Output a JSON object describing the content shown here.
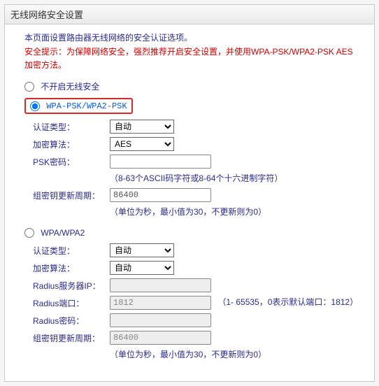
{
  "header": {
    "title": "无线网络安全设置"
  },
  "intro": {
    "line1": "本页面设置路由器无线网络的安全认证选项。",
    "warning": "安全提示：为保障网络安全，强烈推荐开启安全设置，并使用WPA-PSK/WPA2-PSK AES加密方法。"
  },
  "securityMode": {
    "disable": {
      "label": "不开启无线安全",
      "selected": false
    },
    "wpapsk": {
      "label": "WPA-PSK/WPA2-PSK",
      "selected": true
    },
    "wpa": {
      "label": "WPA/WPA2",
      "selected": false
    }
  },
  "wpapsk": {
    "authLabel": "认证类型：",
    "authValue": "自动",
    "encLabel": "加密算法：",
    "encValue": "AES",
    "pskLabel": "PSK密码：",
    "pskValue": "",
    "pskHint": "（8-63个ASCII码字符或8-64个十六进制字符）",
    "groupLabel": "组密钥更新周期：",
    "groupValue": "86400",
    "groupHint": "（单位为秒，最小值为30，不更新则为0）"
  },
  "wpa": {
    "authLabel": "认证类型：",
    "authValue": "自动",
    "encLabel": "加密算法：",
    "encValue": "自动",
    "radiusIpLabel": "Radius服务器IP：",
    "radiusIpValue": "",
    "radiusPortLabel": "Radius端口：",
    "radiusPortValue": "1812",
    "radiusPortHint": "（1- 65535，0表示默认端口：1812）",
    "radiusPwdLabel": "Radius密码：",
    "radiusPwdValue": "",
    "groupLabel": "组密钥更新周期：",
    "groupValue": "86400",
    "groupHint": "（单位为秒，最小值为30，不更新则为0）"
  }
}
